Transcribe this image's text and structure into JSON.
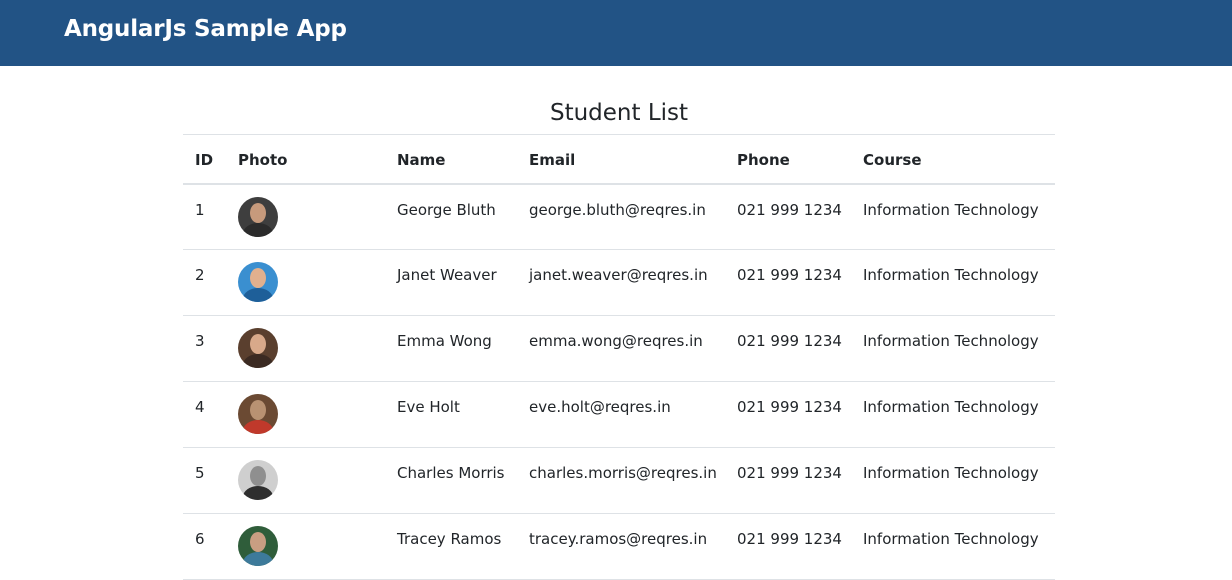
{
  "navbar": {
    "brand": "AngularJs Sample App",
    "bg_color": "#225385"
  },
  "page": {
    "title": "Student List"
  },
  "table": {
    "columns": [
      "ID",
      "Photo",
      "Name",
      "Email",
      "Phone",
      "Course"
    ],
    "rows": [
      {
        "id": "1",
        "photo": "george-bluth-avatar",
        "name": "George Bluth",
        "email": "george.bluth@reqres.in",
        "phone": "021 999 1234",
        "course": "Information Technology",
        "avatar_bg": "#3e3e3e",
        "avatar_skin": "#c79a7c",
        "avatar_cloth": "#2b2b2b"
      },
      {
        "id": "2",
        "photo": "janet-weaver-avatar",
        "name": "Janet Weaver",
        "email": "janet.weaver@reqres.in",
        "phone": "021 999 1234",
        "course": "Information Technology",
        "avatar_bg": "#3a8fd0",
        "avatar_skin": "#e1b08e",
        "avatar_cloth": "#1e5f99"
      },
      {
        "id": "3",
        "photo": "emma-wong-avatar",
        "name": "Emma Wong",
        "email": "emma.wong@reqres.in",
        "phone": "021 999 1234",
        "course": "Information Technology",
        "avatar_bg": "#5a3f2e",
        "avatar_skin": "#d8a98a",
        "avatar_cloth": "#3b2a22"
      },
      {
        "id": "4",
        "photo": "eve-holt-avatar",
        "name": "Eve Holt",
        "email": "eve.holt@reqres.in",
        "phone": "021 999 1234",
        "course": "Information Technology",
        "avatar_bg": "#6b4a33",
        "avatar_skin": "#b99272",
        "avatar_cloth": "#c0392b"
      },
      {
        "id": "5",
        "photo": "charles-morris-avatar",
        "name": "Charles Morris",
        "email": "charles.morris@reqres.in",
        "phone": "021 999 1234",
        "course": "Information Technology",
        "avatar_bg": "#cfcfcf",
        "avatar_skin": "#8f8f8f",
        "avatar_cloth": "#2e2e2e"
      },
      {
        "id": "6",
        "photo": "tracey-ramos-avatar",
        "name": "Tracey Ramos",
        "email": "tracey.ramos@reqres.in",
        "phone": "021 999 1234",
        "course": "Information Technology",
        "avatar_bg": "#2f5d3a",
        "avatar_skin": "#c99e82",
        "avatar_cloth": "#3d7a9a"
      }
    ]
  }
}
